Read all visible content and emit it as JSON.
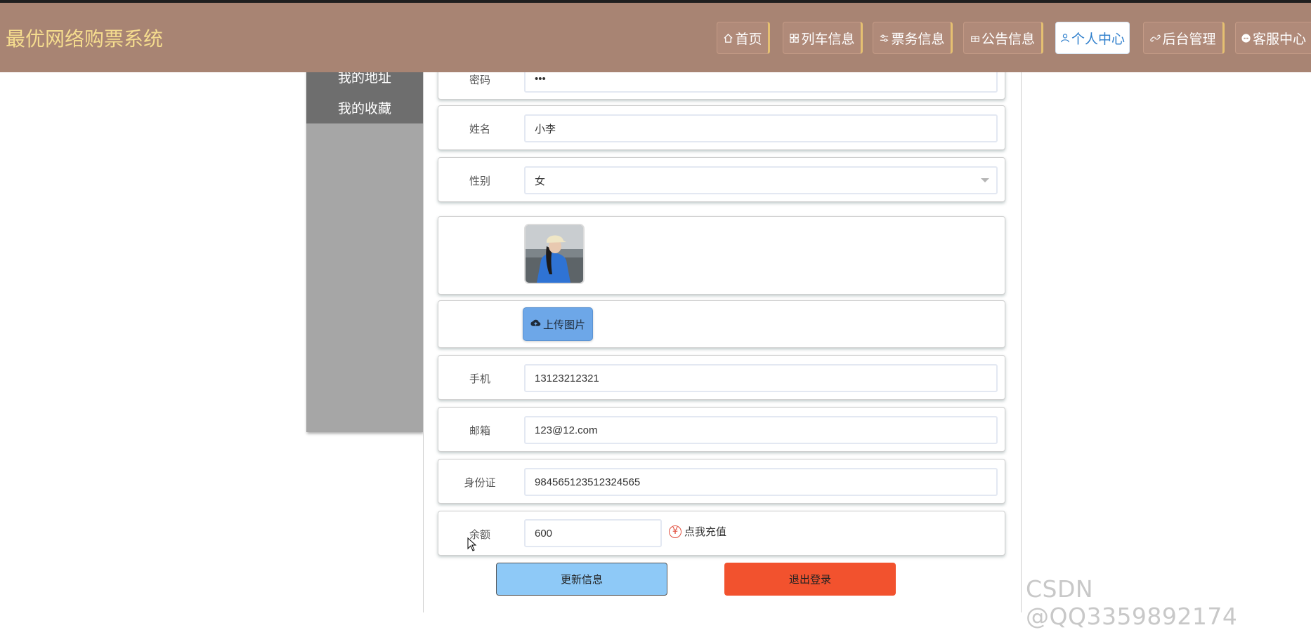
{
  "header": {
    "site_title": "最优网络购票系统",
    "nav": [
      {
        "label": "首页",
        "icon": "home-icon"
      },
      {
        "label": "列车信息",
        "icon": "grid-icon"
      },
      {
        "label": "票务信息",
        "icon": "sliders-icon"
      },
      {
        "label": "公告信息",
        "icon": "gift-icon"
      },
      {
        "label": "个人中心",
        "icon": "user-icon",
        "active": true
      },
      {
        "label": "后台管理",
        "icon": "link-icon"
      },
      {
        "label": "客服中心",
        "icon": "chat-icon"
      }
    ],
    "colors": {
      "bar": "#a88473",
      "title": "#f5dc8e",
      "active_text": "#2f7fcc"
    }
  },
  "sidebar": {
    "items": [
      {
        "label": "我的地址"
      },
      {
        "label": "我的收藏"
      }
    ]
  },
  "form": {
    "password": {
      "label": "密码",
      "value": "•••"
    },
    "name": {
      "label": "姓名",
      "value": "小李"
    },
    "gender": {
      "label": "性别",
      "value": "女"
    },
    "avatar": {
      "alt": "avatar photo"
    },
    "upload": {
      "label": "上传图片",
      "icon": "cloud-upload-icon"
    },
    "phone": {
      "label": "手机",
      "value": "13123212321"
    },
    "email": {
      "label": "邮箱",
      "value": "123@12.com"
    },
    "id_card": {
      "label": "身份证",
      "value": "984565123512324565"
    },
    "balance": {
      "label": "余额",
      "value": "600",
      "recharge_label": "点我充值",
      "recharge_icon": "yen-icon"
    }
  },
  "actions": {
    "update_label": "更新信息",
    "logout_label": "退出登录"
  },
  "watermark": "CSDN @QQ3359892174"
}
